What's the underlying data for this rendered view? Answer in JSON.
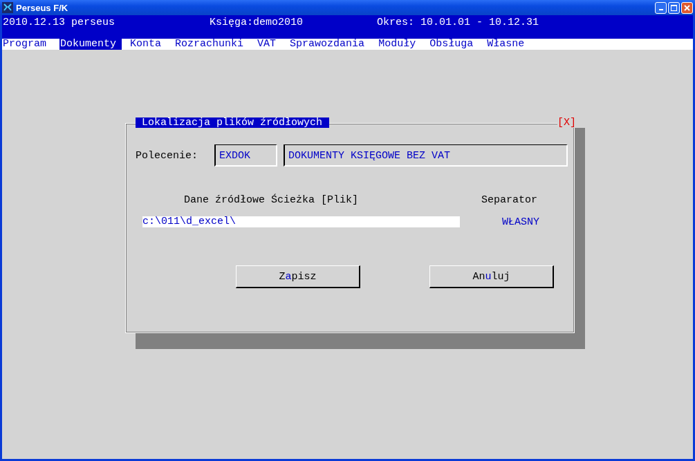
{
  "window": {
    "title": "Perseus F/K"
  },
  "status_line": {
    "date_user": "2010.12.13 perseus",
    "ledger": "Księga:demo2010",
    "period": "Okres: 10.01.01 - 10.12.31"
  },
  "menu": [
    {
      "label": "Program",
      "selected": false
    },
    {
      "label": "Dokumenty",
      "selected": true
    },
    {
      "label": "Konta",
      "selected": false
    },
    {
      "label": "Rozrachunki",
      "selected": false
    },
    {
      "label": "VAT",
      "selected": false
    },
    {
      "label": "Sprawozdania",
      "selected": false
    },
    {
      "label": "Moduły",
      "selected": false
    },
    {
      "label": "Obsługa",
      "selected": false
    },
    {
      "label": "Własne",
      "selected": false
    }
  ],
  "dialog": {
    "title": "Lokalizacja plików źródłowych",
    "close": "[X]",
    "command_label": "Polecenie:",
    "command_code": "EXDOK",
    "command_name": "DOKUMENTY KSIĘGOWE BEZ VAT",
    "path_header": "Dane źródłowe Ścieżka [Plik]",
    "separator_header": "Separator",
    "path_value": "c:\\011\\d_excel\\",
    "separator_value": "WŁASNY",
    "buttons": [
      {
        "label_before": "Z",
        "hotkey": "a",
        "label_after": "pisz"
      },
      {
        "label_before": "An",
        "hotkey": "u",
        "label_after": "luj"
      }
    ]
  }
}
